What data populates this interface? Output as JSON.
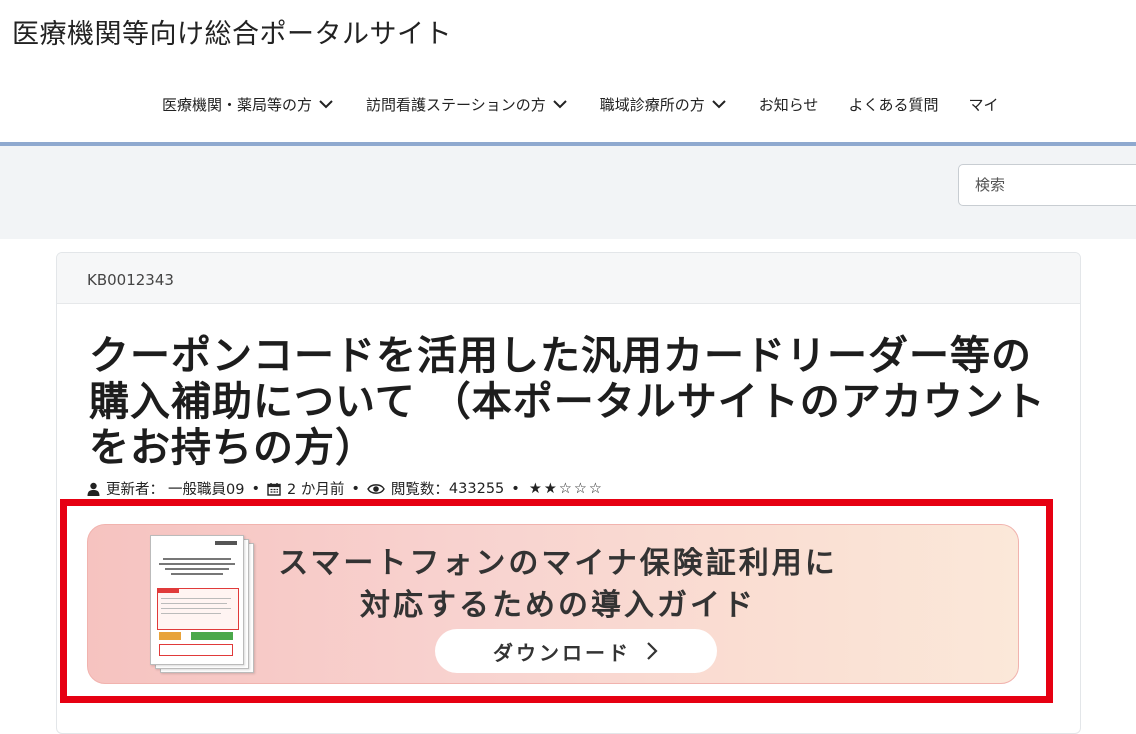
{
  "site": {
    "title": "医療機関等向け総合ポータルサイト"
  },
  "nav": {
    "items": [
      {
        "label": "医療機関・薬局等の方",
        "has_dropdown": true,
        "icon": "chevron-down-icon"
      },
      {
        "label": "訪問看護ステーションの方",
        "has_dropdown": true,
        "icon": "chevron-down-icon"
      },
      {
        "label": "職域診療所の方",
        "has_dropdown": true,
        "icon": "chevron-down-icon"
      },
      {
        "label": "お知らせ",
        "has_dropdown": false
      },
      {
        "label": "よくある質問",
        "has_dropdown": false
      },
      {
        "label": "マイ",
        "has_dropdown": false
      }
    ],
    "divider_color": "#8fa9cf"
  },
  "search": {
    "placeholder": "検索"
  },
  "article": {
    "kb_number": "KB0012343",
    "title": "クーポンコードを活用した汎用カードリーダー等の購入補助について （本ポータルサイトのアカウントをお持ちの方）",
    "meta": {
      "author_label": "更新者：",
      "author": "一般職員09",
      "date": "2 か月前",
      "views_label": "閲覧数：",
      "views": "433255",
      "rating_display": "★★☆☆☆",
      "rating_value": 2,
      "rating_max": 5
    }
  },
  "banner": {
    "line1": "スマートフォンのマイナ保険証利用に",
    "line2": "対応するための導入ガイド",
    "button_label": "ダウンロード",
    "button_icon": "chevron-right-icon",
    "highlight_color": "#e60012"
  }
}
